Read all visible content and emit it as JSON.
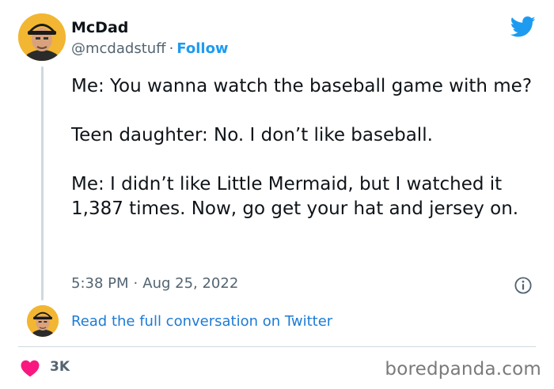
{
  "tweet": {
    "author_name": "McDad",
    "author_handle": "@mcdadstuff",
    "separator": "·",
    "follow_label": "Follow",
    "paragraphs": [
      "Me: You wanna watch the baseball game with me?",
      "Teen daughter: No. I don’t like baseball.",
      "Me: I didn’t like Little Mermaid, but I watched it 1,387 times. Now, go get your hat and jersey on."
    ],
    "time": "5:38 PM",
    "date": "Aug 25, 2022",
    "read_conversation_label": "Read the full conversation on Twitter",
    "like_count": "3K"
  },
  "watermark": "boredpanda.com",
  "icons": {
    "brand": "twitter-bird-icon",
    "info": "info-icon",
    "like": "heart-icon"
  },
  "colors": {
    "link": "#1d9bf0",
    "heart": "#f91880",
    "secondary_text": "#536471",
    "avatar_bg": "#f2b632"
  }
}
